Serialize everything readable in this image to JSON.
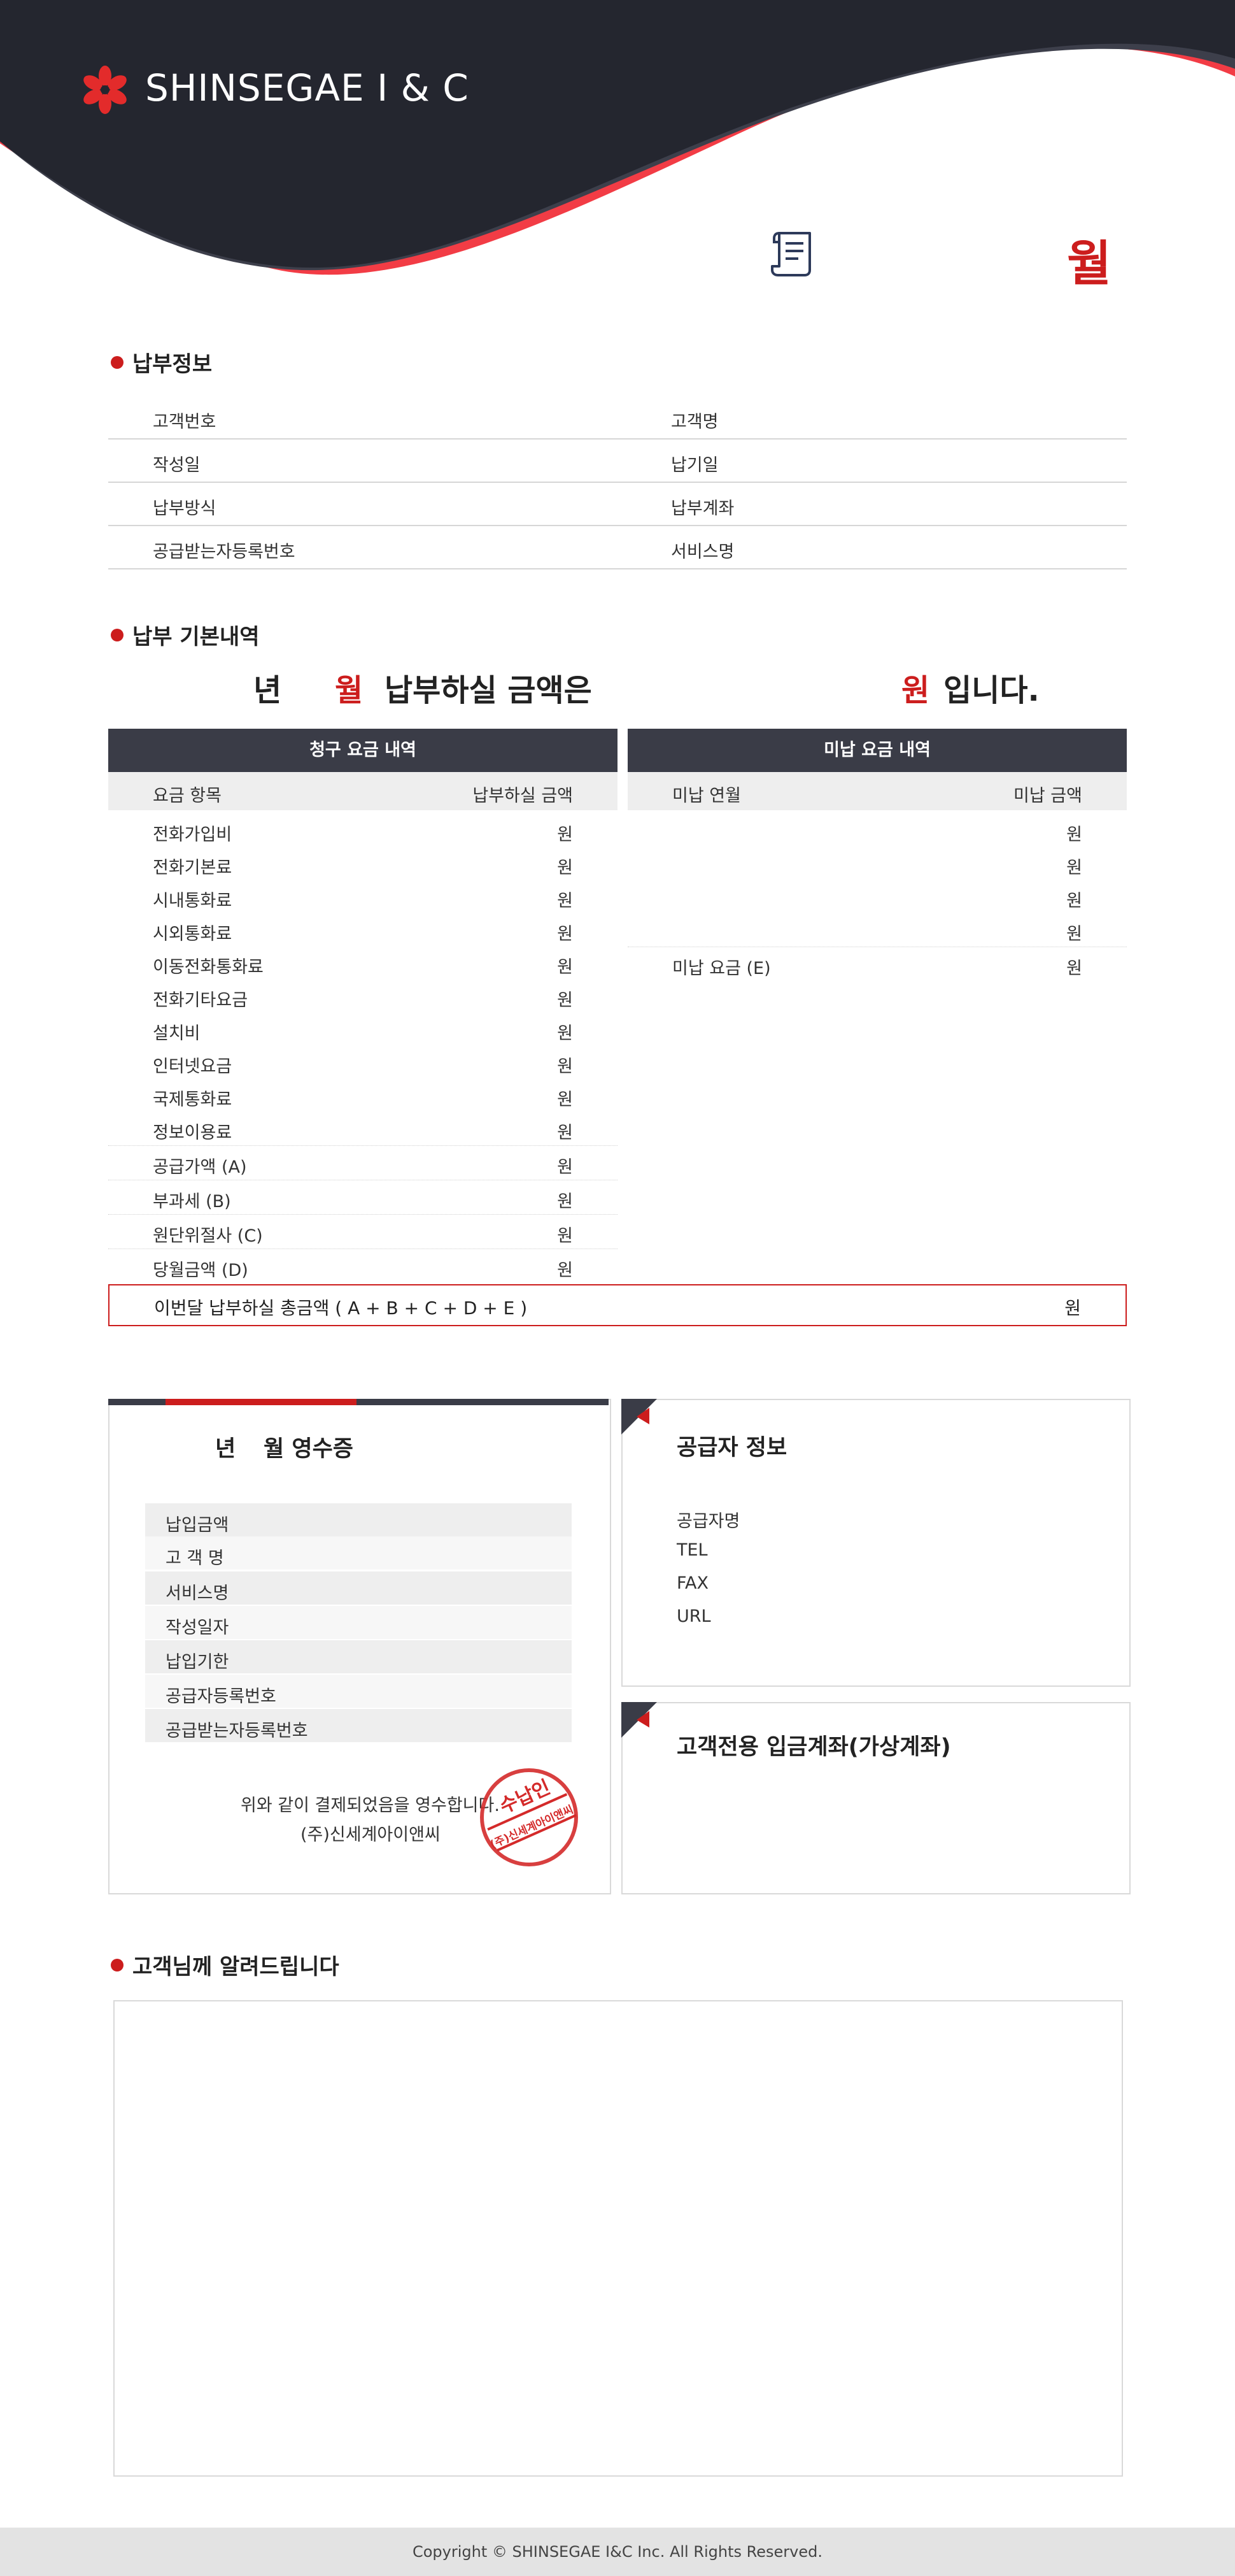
{
  "brand": {
    "name": "SHINSEGAE I & C"
  },
  "header": {
    "month_label": "월"
  },
  "payment_info": {
    "title": "납부정보",
    "rows": [
      {
        "left": "고객번호",
        "right": "고객명"
      },
      {
        "left": "작성일",
        "right": "납기일"
      },
      {
        "left": "납부방식",
        "right": "납부계좌"
      },
      {
        "left": "공급받는자등록번호",
        "right": "서비스명"
      }
    ]
  },
  "basic": {
    "title": "납부 기본내역",
    "summary": {
      "year": "년",
      "month": "월",
      "text": "납부하실 금액은",
      "won": "원",
      "end": "입니다."
    }
  },
  "billing": {
    "title": "청구 요금 내역",
    "col_item": "요금 항목",
    "col_amount": "납부하실 금액",
    "items": [
      {
        "label": "전화가입비",
        "unit": "원"
      },
      {
        "label": "전화기본료",
        "unit": "원"
      },
      {
        "label": "시내통화료",
        "unit": "원"
      },
      {
        "label": "시외통화료",
        "unit": "원"
      },
      {
        "label": "이동전화통화료",
        "unit": "원"
      },
      {
        "label": "전화기타요금",
        "unit": "원"
      },
      {
        "label": "설치비",
        "unit": "원"
      },
      {
        "label": "인터넷요금",
        "unit": "원"
      },
      {
        "label": "국제통화료",
        "unit": "원"
      },
      {
        "label": "정보이용료",
        "unit": "원"
      },
      {
        "label": "공급가액 (A)",
        "unit": "원"
      },
      {
        "label": "부과세 (B)",
        "unit": "원"
      },
      {
        "label": "원단위절사 (C)",
        "unit": "원"
      },
      {
        "label": "당월금액 (D)",
        "unit": "원"
      }
    ]
  },
  "unpaid": {
    "title": "미납 요금 내역",
    "col_month": "미납 연월",
    "col_amount": "미납 금액",
    "rows": [
      {
        "unit": "원"
      },
      {
        "unit": "원"
      },
      {
        "unit": "원"
      },
      {
        "unit": "원"
      }
    ],
    "total": {
      "label": "미납 요금 (E)",
      "unit": "원"
    }
  },
  "grand_total": {
    "label": "이번달 납부하실 총금액 ( A + B + C + D + E )",
    "unit": "원"
  },
  "receipt": {
    "year": "년",
    "month_title": "월 영수증",
    "rows": [
      "납입금액",
      "고 객 명",
      "서비스명",
      "작성일자",
      "납입기한",
      "공급자등록번호",
      "공급받는자등록번호"
    ],
    "confirm": "위와 같이 결제되었음을 영수합니다.",
    "company": "(주)신세계아이앤씨",
    "stamp_top": "수납인",
    "stamp_bottom": "(주)신세계아이앤씨"
  },
  "supplier": {
    "title": "공급자 정보",
    "rows": [
      "공급자명",
      "TEL",
      "FAX",
      "URL"
    ]
  },
  "virtual_account": {
    "title": "고객전용 입금계좌(가상계좌)"
  },
  "notice": {
    "title": "고객님께 알려드립니다"
  },
  "footer": {
    "copyright": "Copyright © SHINSEGAE I&C Inc. All Rights Reserved."
  },
  "colors": {
    "accent": "#cc1d1d",
    "dark": "#2a2c37",
    "red_wave": "#f23c45"
  }
}
